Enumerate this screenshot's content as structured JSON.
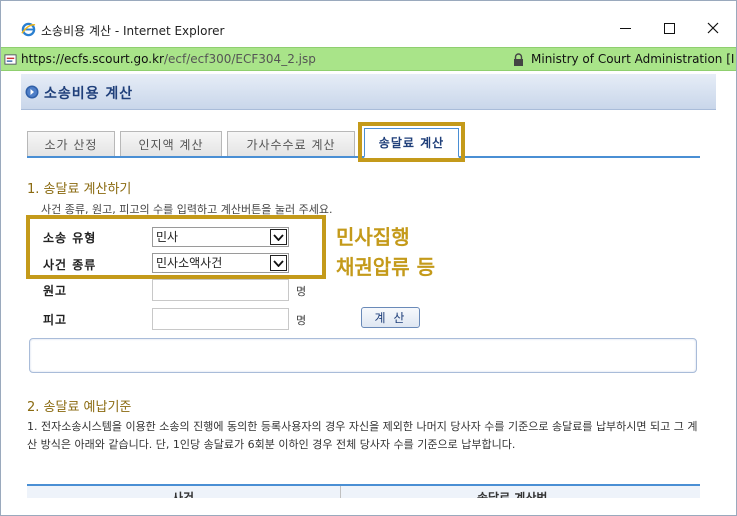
{
  "window": {
    "title": "소송비용 계산 - Internet Explorer",
    "icon": "ie-icon"
  },
  "address": {
    "url_host": "https://ecfs.scourt.go.kr",
    "url_path": "/ecf/ecf300/ECF304_2.jsp",
    "site_name": "Ministry of Court Administration [I"
  },
  "page": {
    "title": "소송비용 계산"
  },
  "tabs": [
    {
      "label": "소가 산정"
    },
    {
      "label": "인지액 계산"
    },
    {
      "label": "가사수수료 계산"
    },
    {
      "label": "송달료 계산",
      "active": true
    }
  ],
  "section1": {
    "title": "1. 송달료 계산하기",
    "description": "사건 종류, 원고, 피고의 수를 입력하고 계산버튼을 눌러 주세요.",
    "fields": {
      "case_type_label": "소송 유형",
      "case_type_value": "민사",
      "case_kind_label": "사건 종류",
      "case_kind_value": "민사소액사건",
      "plaintiff_label": "원고",
      "defendant_label": "피고",
      "unit": "명"
    },
    "calc_button": "계 산"
  },
  "annotation": {
    "line1": "민사집행",
    "line2": "채권압류 등"
  },
  "section2": {
    "title": "2. 송달료 예납기준",
    "body": "1. 전자소송시스템을 이용한 소송의 진행에 동의한 등록사용자의 경우 자신을 제외한 나머지 당사자 수를 기준으로 송달료를 납부하시면 되고 그 계산 방식은 아래와 같습니다. 단, 1인당 송달료가 6회분 이하인 경우 전체 당사자 수를 기준으로 납부합니다."
  },
  "table": {
    "headers": [
      "사건",
      "송달료 계산법"
    ]
  },
  "colors": {
    "highlight": "#c49a1a",
    "address_bar": "#a9e489",
    "header_text": "#1f3f7a",
    "tab_accent": "#4a8fd4"
  }
}
